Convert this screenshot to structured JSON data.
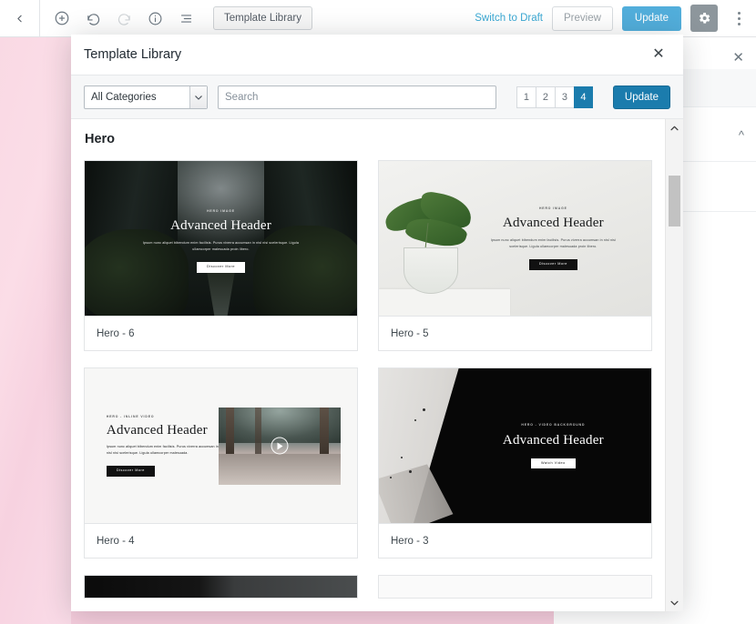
{
  "toolbar": {
    "back_icon": "chevron-left-icon",
    "add_icon": "plus-circle-icon",
    "undo_icon": "undo-icon",
    "redo_icon": "redo-icon",
    "info_icon": "info-circle-icon",
    "list_view_icon": "list-view-icon",
    "template_library_label": "Template Library",
    "switch_to_draft_label": "Switch to Draft",
    "preview_label": "Preview",
    "update_label": "Update",
    "settings_icon": "gear-icon",
    "more_icon": "more-vertical-icon",
    "accent_blue": "#52aedb",
    "link_blue": "#3ba9d4"
  },
  "modal": {
    "title": "Template Library",
    "close_icon": "close-icon",
    "filters": {
      "category_selected": "All Categories",
      "category_caret_icon": "chevron-down-icon",
      "search_value": "",
      "search_placeholder": "Search"
    },
    "pagination": {
      "pages": [
        "1",
        "2",
        "3",
        "4"
      ],
      "active_page": "4",
      "active_color": "#1b7cad"
    },
    "update_label": "Update",
    "section_title": "Hero",
    "cards": [
      {
        "label": "Hero - 6",
        "eyebrow": "HERO IMAGE",
        "heading": "Advanced Header",
        "body": "Ipsum nunc aliquet bibendum enim facilisis. Purus viverra accumsan in nisl nisi scelerisque. Ligula ullamcorper malesuada proin libero.",
        "button": "Discover More",
        "style": "dark-city"
      },
      {
        "label": "Hero - 5",
        "eyebrow": "HERO IMAGE",
        "heading": "Advanced Header",
        "body": "Ipsum nunc aliquet bibendum enim facilisis. Purus viverra accumsan in nisl nisi scelerisque. Ligula ullamcorper malesuada proin libero.",
        "button": "Discover More",
        "style": "light-plant"
      },
      {
        "label": "Hero - 4",
        "eyebrow": "HERO - INLINE VIDEO",
        "heading": "Advanced Header",
        "body": "Ipsum nunc aliquet bibendum enim facilisis. Purus viverra accumsan in nisl nisi scelerisque. Ligula ullamcorper malesuada.",
        "button": "Discover More",
        "play_icon": "play-icon",
        "style": "inline-video"
      },
      {
        "label": "Hero - 3",
        "eyebrow": "HERO - VIDEO BACKGROUND",
        "heading": "Advanced Header",
        "button": "Watch Video",
        "style": "brush-dark"
      }
    ],
    "scrollbar": {
      "up_icon": "chevron-up-icon",
      "down_icon": "chevron-down-icon"
    }
  },
  "background": {
    "close_icon": "close-icon",
    "collapse_icon": "chevron-up-icon"
  }
}
